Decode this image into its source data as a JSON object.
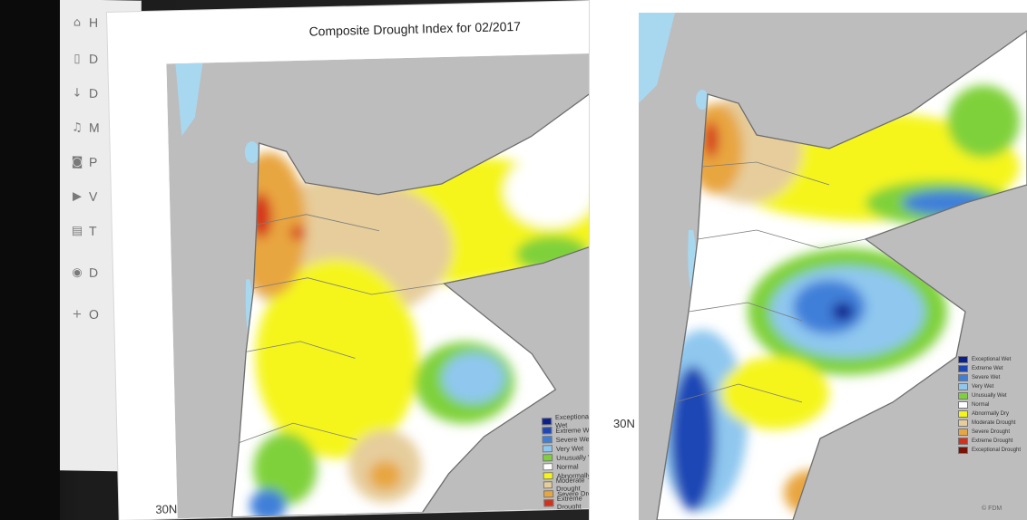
{
  "sidebar": {
    "items": [
      {
        "icon": "home-icon",
        "glyph": "⌂",
        "label": "H"
      },
      {
        "icon": "document-icon",
        "glyph": "▯",
        "label": "D"
      },
      {
        "icon": "download-icon",
        "glyph": "↓",
        "label": "D"
      },
      {
        "icon": "music-icon",
        "glyph": "♫",
        "label": "M"
      },
      {
        "icon": "camera-icon",
        "glyph": "◙",
        "label": "P"
      },
      {
        "icon": "video-icon",
        "glyph": "▶",
        "label": "V"
      },
      {
        "icon": "trash-icon",
        "glyph": "▤",
        "label": "T"
      },
      {
        "icon": "drive-icon",
        "glyph": "◉",
        "label": "D"
      },
      {
        "icon": "plus-icon",
        "glyph": "+",
        "label": "O"
      }
    ]
  },
  "left_map": {
    "title": "Composite Drought Index for 02/2017",
    "lat_label": "30N",
    "legend": [
      {
        "label": "Exceptional Wet",
        "color": "#0a1f8c"
      },
      {
        "label": "Extreme Wet",
        "color": "#1e47b5"
      },
      {
        "label": "Severe Wet",
        "color": "#3f7fd9"
      },
      {
        "label": "Very Wet",
        "color": "#8fc7ef"
      },
      {
        "label": "Unusually Wet",
        "color": "#7fd13b"
      },
      {
        "label": "Normal",
        "color": "#ffffff"
      },
      {
        "label": "Abnormally Dry",
        "color": "#f5f51a"
      },
      {
        "label": "Moderate Drought",
        "color": "#e6cd9b"
      },
      {
        "label": "Severe Drought",
        "color": "#e8a640"
      },
      {
        "label": "Extreme Drought",
        "color": "#d4301b"
      }
    ]
  },
  "right_map": {
    "lat_label": "30N",
    "legend": [
      {
        "label": "Exceptional Wet",
        "color": "#0a1f8c"
      },
      {
        "label": "Extreme Wet",
        "color": "#1e47b5"
      },
      {
        "label": "Severe Wet",
        "color": "#3f7fd9"
      },
      {
        "label": "Very Wet",
        "color": "#8fc7ef"
      },
      {
        "label": "Unusually Wet",
        "color": "#7fd13b"
      },
      {
        "label": "Normal",
        "color": "#ffffff"
      },
      {
        "label": "Abnormally Dry",
        "color": "#f5f51a"
      },
      {
        "label": "Moderate Drought",
        "color": "#e6cd9b"
      },
      {
        "label": "Severe Drought",
        "color": "#e8a640"
      },
      {
        "label": "Extreme Drought",
        "color": "#d4301b"
      },
      {
        "label": "Exceptional Drought",
        "color": "#7a1208"
      }
    ],
    "credit": "© FDM"
  },
  "colors": {
    "sea_gray": "#bdbdbd",
    "water_blue": "#a8d8f0",
    "border_gray": "#6e6e6e"
  }
}
